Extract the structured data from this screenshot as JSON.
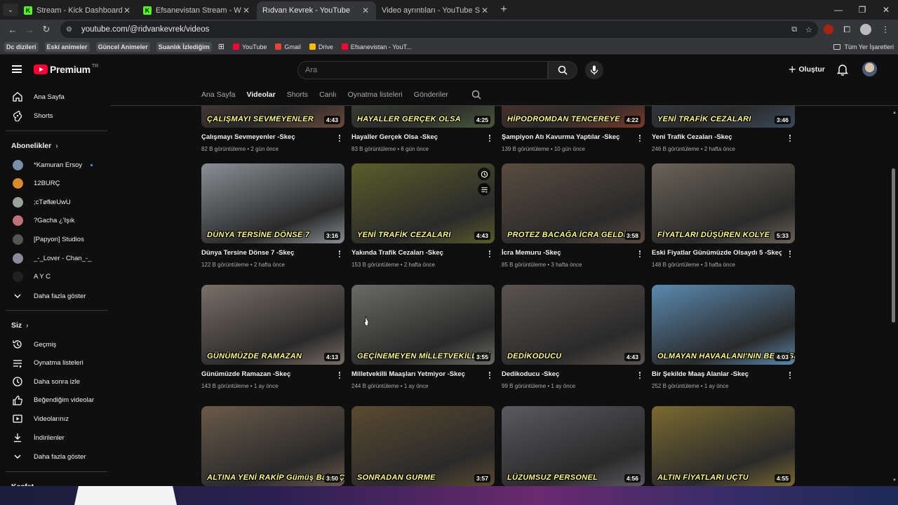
{
  "browser": {
    "tabs": [
      {
        "title": "Stream - Kick Dashboard",
        "favicon": "kick",
        "active": false
      },
      {
        "title": "Efsanevistan Stream - Watch Li...",
        "favicon": "kick",
        "active": false
      },
      {
        "title": "Rıdvan Kevrek - YouTube",
        "favicon": "youtube",
        "active": true
      },
      {
        "title": "Video ayrıntıları - YouTube Stud...",
        "favicon": "youtube",
        "active": false
      }
    ],
    "url": "youtube.com/@ridvankevrek/videos",
    "bookmarks": [
      {
        "label": "Dc dizileri",
        "boxed": true
      },
      {
        "label": "Eski animeler",
        "boxed": true
      },
      {
        "label": "Güncel Animeler",
        "boxed": true
      },
      {
        "label": "Suanlık İzlediğim",
        "boxed": true
      },
      {
        "label": "YouTube",
        "color": "#ff0033"
      },
      {
        "label": "Gmail",
        "color": "#ea4335"
      },
      {
        "label": "Drive",
        "color": "#fbbc04"
      },
      {
        "label": "Efsanevistan - YouT...",
        "color": "#ff0033"
      }
    ],
    "all_bookmarks_label": "Tüm Yer İşaretleri"
  },
  "youtube": {
    "logo_text": "Premium",
    "logo_region": "TR",
    "search_placeholder": "Ara",
    "create_label": "Oluştur",
    "sidebar": {
      "main": [
        {
          "label": "Ana Sayfa",
          "icon": "home-icon"
        },
        {
          "label": "Shorts",
          "icon": "shorts-icon"
        }
      ],
      "subscriptions_header": "Abonelikler",
      "subscriptions": [
        {
          "label": "*Kamuran Ersoy",
          "color": "#7a8fa8",
          "live": true
        },
        {
          "label": "12BURÇ",
          "color": "#d98a2b",
          "live": false
        },
        {
          "label": ";cTøfłæUwU",
          "color": "#9aa09a",
          "live": false
        },
        {
          "label": "?Gacha ¿'Işık",
          "color": "#c2737a",
          "live": false
        },
        {
          "label": "[Papyon] Studios",
          "color": "#555555",
          "live": false
        },
        {
          "label": "_-_Lover - Chan_-_",
          "color": "#8a8a9a",
          "live": false
        },
        {
          "label": "A Y C",
          "color": "#222222",
          "live": false
        }
      ],
      "show_more_label": "Daha fazla göster",
      "you_header": "Siz",
      "you_items": [
        {
          "label": "Geçmiş",
          "icon": "history-icon"
        },
        {
          "label": "Oynatma listeleri",
          "icon": "playlists-icon"
        },
        {
          "label": "Daha sonra izle",
          "icon": "watch-later-icon"
        },
        {
          "label": "Beğendiğim videolar",
          "icon": "like-icon"
        },
        {
          "label": "Videolarınız",
          "icon": "your-videos-icon"
        },
        {
          "label": "İndirilenler",
          "icon": "download-icon"
        }
      ],
      "you_show_more_label": "Daha fazla göster",
      "explore_header": "Keşfet"
    },
    "channel_tabs": [
      "Ana Sayfa",
      "Videolar",
      "Shorts",
      "Canlı",
      "Oynatma listeleri",
      "Gönderiler"
    ],
    "active_tab": "Videolar",
    "videos": [
      {
        "title": "Çalışmayı Sevmeyenler -Skeç",
        "views": "82 B görüntüleme",
        "age": "2 gün önce",
        "duration": "4:43",
        "caption": "ÇALIŞMAYI SEVMEYENLER",
        "bg": "#6a4a3a"
      },
      {
        "title": "Hayaller Gerçek Olsa -Skeç",
        "views": "83 B görüntüleme",
        "age": "6 gün önce",
        "duration": "4:25",
        "caption": "HAYALLER GERÇEK OLSA",
        "bg": "#4a5a3a"
      },
      {
        "title": "Şampiyon Atı Kavurma Yaptılar -Skeç",
        "views": "139 B görüntüleme",
        "age": "10 gün önce",
        "duration": "4:22",
        "caption": "HİPODROMDAN TENCEREYE",
        "bg": "#7a3a2a"
      },
      {
        "title": "Yeni Trafik Cezaları -Skeç",
        "views": "246 B görüntüleme",
        "age": "2 hafta önce",
        "duration": "3:46",
        "caption": "YENİ TRAFİK CEZALARI",
        "bg": "#3a4a5a"
      },
      {
        "title": "Dünya Tersine Dönse 7 -Skeç",
        "views": "122 B görüntüleme",
        "age": "2 hafta önce",
        "duration": "3:16",
        "caption": "DÜNYA TERSİNE DÖNSE 7",
        "bg": "#8a8f94"
      },
      {
        "title": "Yakında Trafik Cezaları -Skeç",
        "views": "153 B görüntüleme",
        "age": "2 hafta önce",
        "duration": "4:43",
        "caption": "YENİ TRAFİK CEZALARI",
        "bg": "#5a5d2a"
      },
      {
        "title": "İcra Memuru -Skeç",
        "views": "85 B görüntüleme",
        "age": "3 hafta önce",
        "duration": "3:58",
        "caption": "PROTEZ BACAĞA İCRA GELDİ",
        "bg": "#5a4c40"
      },
      {
        "title": "Eski Fiyatlar Günümüzde Olsaydı 5 -Skeç",
        "views": "148 B görüntüleme",
        "age": "3 hafta önce",
        "duration": "5:33",
        "caption": "FİYATLARI DÜŞÜREN KOLYE",
        "bg": "#6a6458"
      },
      {
        "title": "Günümüzde Ramazan -Skeç",
        "views": "143 B görüntüleme",
        "age": "1 ay önce",
        "duration": "4:13",
        "caption": "GÜNÜMÜZDE RAMAZAN",
        "bg": "#7a6f68"
      },
      {
        "title": "Milletvekilli Maaşları Yetmiyor -Skeç",
        "views": "244 B görüntüleme",
        "age": "1 ay önce",
        "duration": "3:55",
        "caption": "GEÇİNEMEYEN MİLLETVEKİLLERİ",
        "bg": "#6a6a66"
      },
      {
        "title": "Dedikoducu -Skeç",
        "views": "99 B görüntüleme",
        "age": "1 ay önce",
        "duration": "4:43",
        "caption": "DEDİKODUCU",
        "bg": "#5a5450"
      },
      {
        "title": "Bir Şekilde Maaş Alanlar -Skeç",
        "views": "252 B görüntüleme",
        "age": "1 ay önce",
        "duration": "4:03",
        "caption": "OLMAYAN HAVAALANI'NIN BEKÇİSİ EMEKLİ OLDU",
        "bg": "#5a8ab0"
      },
      {
        "title": "",
        "views": "",
        "age": "",
        "duration": "3:50",
        "caption": "ALTINA YENİ RAKİP Gümüş Bakır Çelik",
        "bg": "#6a5a4a"
      },
      {
        "title": "",
        "views": "",
        "age": "",
        "duration": "3:57",
        "caption": "SONRADAN GURME",
        "bg": "#5a4a30"
      },
      {
        "title": "",
        "views": "",
        "age": "",
        "duration": "4:56",
        "caption": "LÜZUMSUZ PERSONEL",
        "bg": "#5a5a60"
      },
      {
        "title": "",
        "views": "",
        "age": "",
        "duration": "4:55",
        "caption": "ALTIN FİYATLARI UÇTU",
        "bg": "#7a6a30"
      }
    ]
  },
  "colors": {
    "accent": "#ff0033",
    "kick": "#53fc18",
    "link_blue": "#3ea6ff"
  }
}
